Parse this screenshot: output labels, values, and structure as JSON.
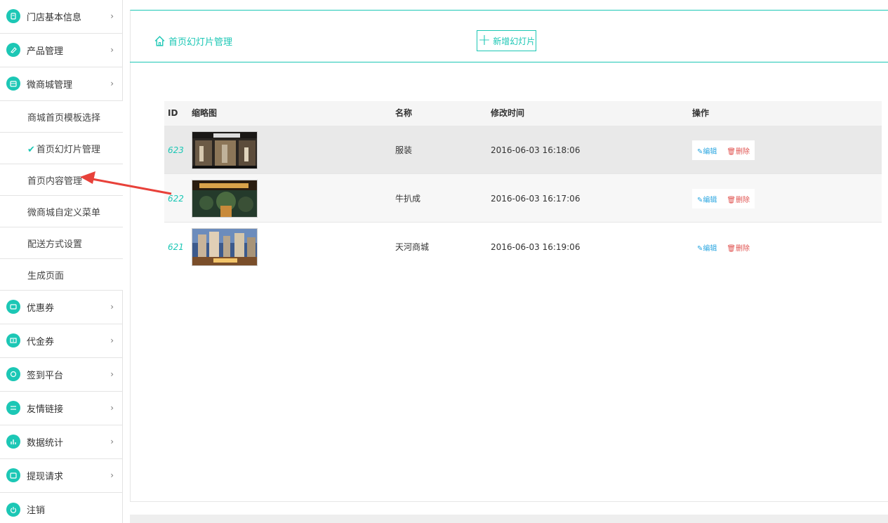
{
  "colors": {
    "accent": "#1cc7b5",
    "arrow": "#e8413a",
    "edit": "#2aa6e0",
    "delete": "#e0524f"
  },
  "sidebar": {
    "items": [
      {
        "label": "门店基本信息",
        "icon": "store-icon",
        "type": "main"
      },
      {
        "label": "产品管理",
        "icon": "tag-icon",
        "type": "main"
      },
      {
        "label": "微商城管理",
        "icon": "shop-icon",
        "type": "main"
      },
      {
        "label": "商城首页模板选择",
        "type": "sub"
      },
      {
        "label": "首页幻灯片管理",
        "type": "sub",
        "active": true,
        "check": "✔"
      },
      {
        "label": "首页内容管理",
        "type": "sub"
      },
      {
        "label": "微商城自定义菜单",
        "type": "sub"
      },
      {
        "label": "配送方式设置",
        "type": "sub"
      },
      {
        "label": "生成页面",
        "type": "sub"
      },
      {
        "label": "优惠券",
        "icon": "coupon-icon",
        "type": "main"
      },
      {
        "label": "代金券",
        "icon": "voucher-icon",
        "type": "main"
      },
      {
        "label": "签到平台",
        "icon": "checkin-icon",
        "type": "main"
      },
      {
        "label": "友情链接",
        "icon": "link-icon",
        "type": "main"
      },
      {
        "label": "数据统计",
        "icon": "chart-icon",
        "type": "main"
      },
      {
        "label": "提现请求",
        "icon": "wallet-icon",
        "type": "main"
      },
      {
        "label": "注销",
        "icon": "power-icon",
        "type": "main"
      }
    ],
    "chevron": "›"
  },
  "header": {
    "breadcrumb": "首页幻灯片管理",
    "add_button": "新增幻灯片",
    "add_plus": "+"
  },
  "table": {
    "columns": [
      "ID",
      "缩略图",
      "名称",
      "修改时间",
      "操作"
    ],
    "rows": [
      {
        "id": "623",
        "name": "服装",
        "time": "2016-06-03 16:18:06",
        "edit": "编辑",
        "delete": "删除"
      },
      {
        "id": "622",
        "name": "牛扒成",
        "time": "2016-06-03 16:17:06",
        "edit": "编辑",
        "delete": "删除"
      },
      {
        "id": "621",
        "name": "天河商城",
        "time": "2016-06-03 16:19:06",
        "edit": "编辑",
        "delete": "删除"
      }
    ]
  }
}
